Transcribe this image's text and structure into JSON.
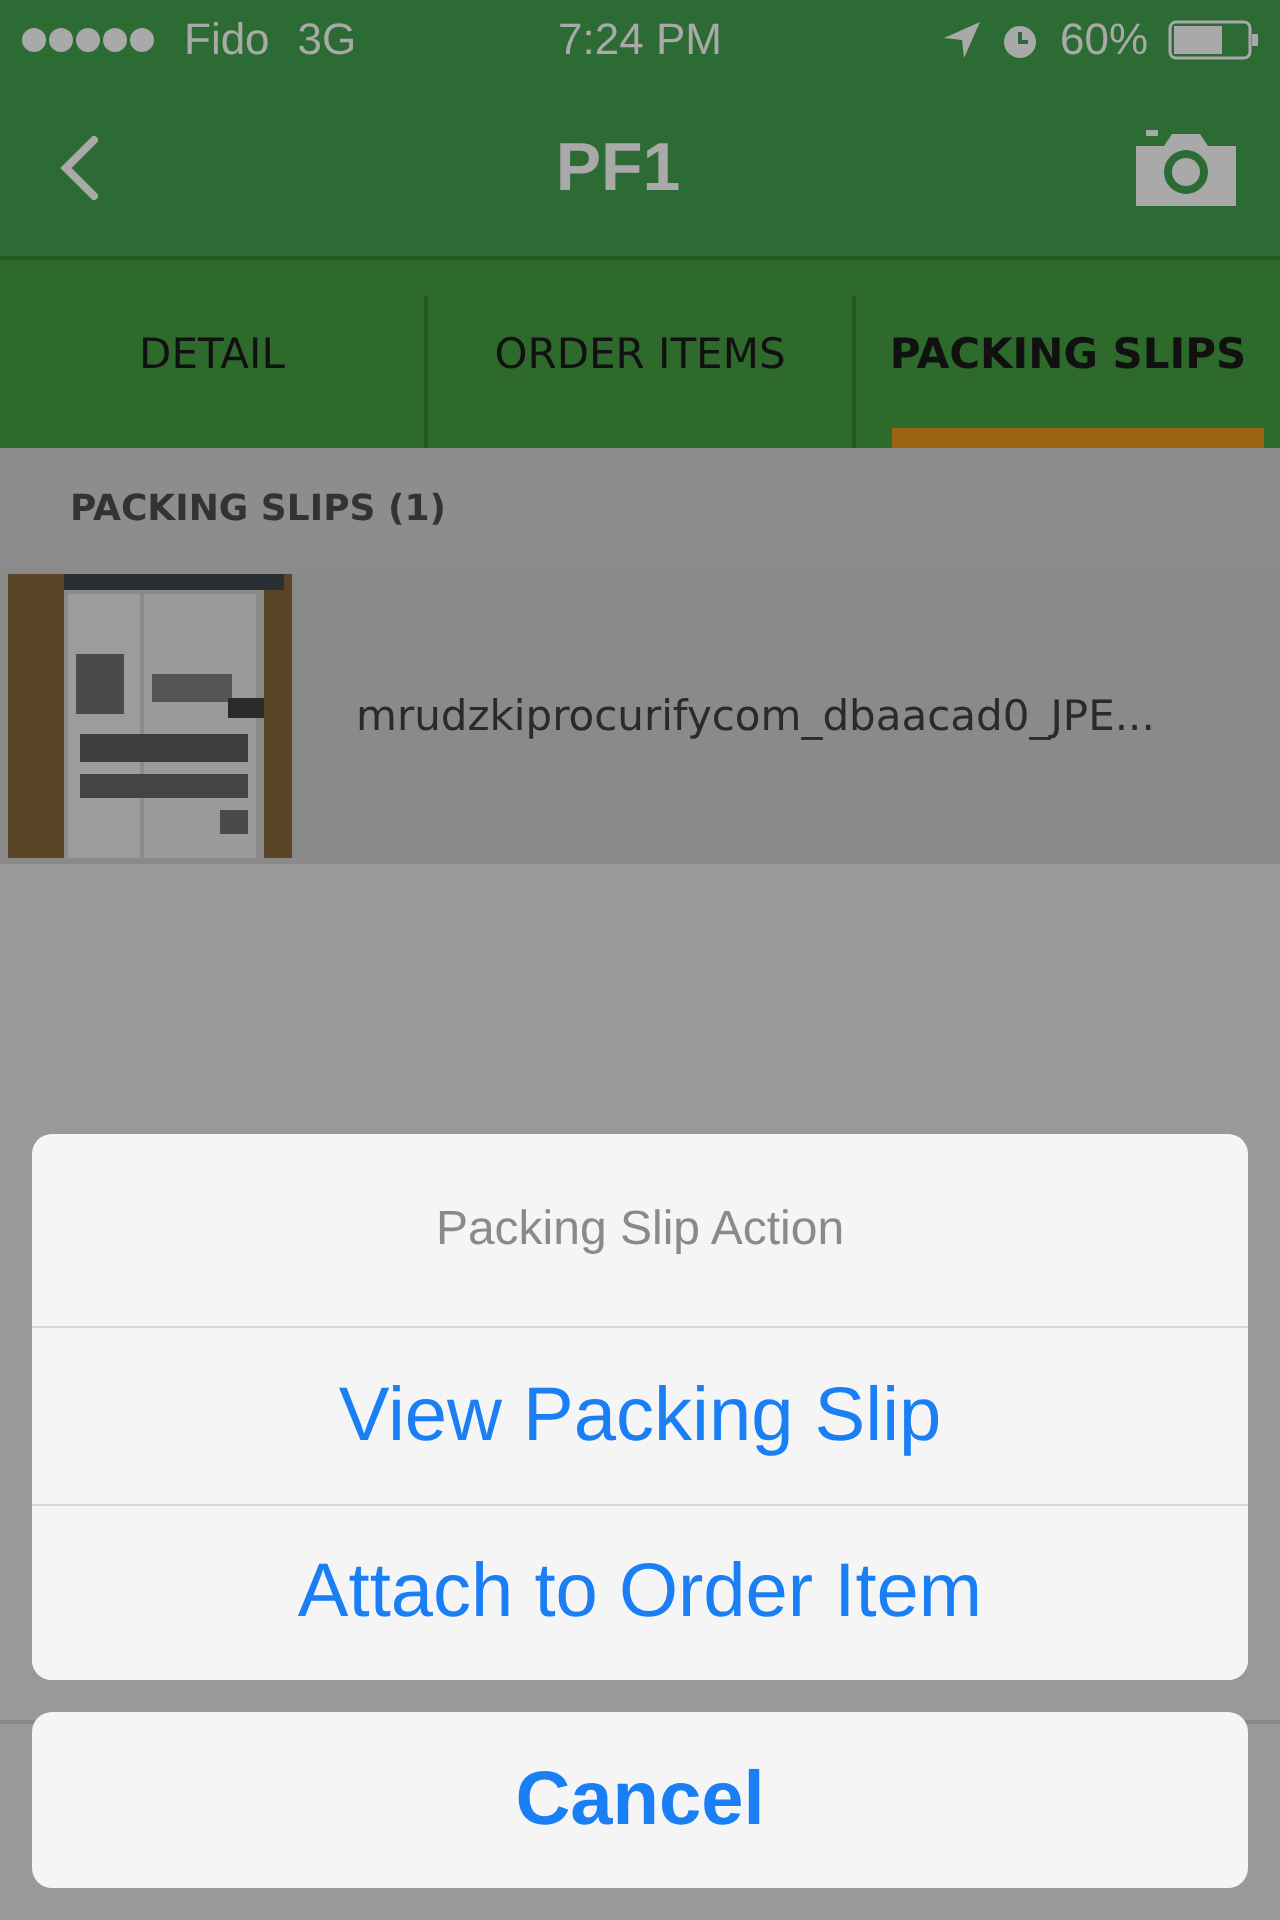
{
  "status_bar": {
    "carrier": "Fido",
    "network": "3G",
    "time": "7:24 PM",
    "battery": "60%"
  },
  "nav": {
    "title": "PF1"
  },
  "tabs": [
    {
      "label": "DETAIL",
      "selected": false
    },
    {
      "label": "ORDER ITEMS",
      "selected": false
    },
    {
      "label": "PACKING SLIPS",
      "selected": true
    }
  ],
  "section": {
    "title": "PACKING SLIPS (1)"
  },
  "slips": [
    {
      "file": "mrudzkiprocurifycom_dbaacad0_JPE..."
    }
  ],
  "action_sheet": {
    "title": "Packing Slip Action",
    "actions": [
      "View Packing Slip",
      "Attach to Order Item"
    ],
    "cancel": "Cancel"
  }
}
